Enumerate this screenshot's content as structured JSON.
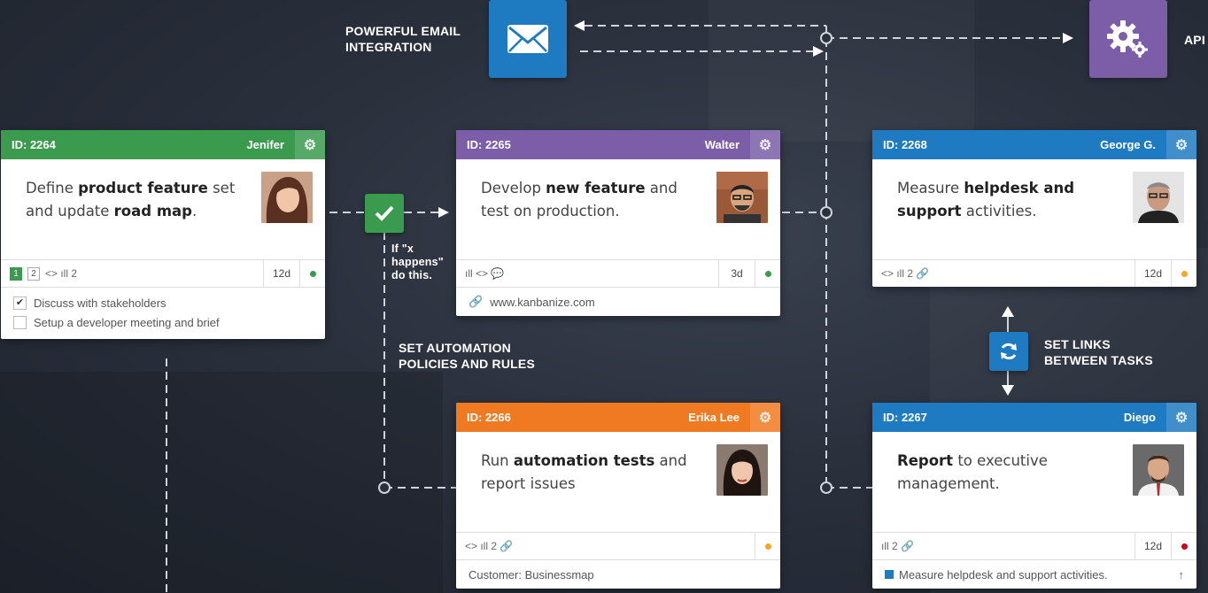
{
  "labels": {
    "email": "POWERFUL EMAIL\nINTEGRATION",
    "api": "API",
    "condition": "If \"x\nhappens\"\ndo this.",
    "automation": "SET AUTOMATION\nPOLICIES AND RULES",
    "links": "SET LINKS\nBETWEEN TASKS"
  },
  "icons": {
    "email": "envelope-icon",
    "api": "gears-icon",
    "rule": "checkmark-icon",
    "link": "refresh-link-icon"
  },
  "colors": {
    "green": "#3a9a4e",
    "purple": "#7b5ea7",
    "blue": "#1f7bc1",
    "orange": "#f07a22",
    "email_box": "#1f7bc1",
    "api_box": "#7b5ea7"
  },
  "cards": {
    "c2264": {
      "id": "ID: 2264",
      "owner": "Jenifer",
      "title_pre": "Define ",
      "title_b1": "product feature",
      "title_mid": " set and update ",
      "title_b2": "road map",
      "title_post": ".",
      "footer_icons": "<> ıll 2",
      "badge1": "1",
      "badge2": "2",
      "days": "12d",
      "checklist": [
        {
          "checked": true,
          "text": "Discuss with stakeholders"
        },
        {
          "checked": false,
          "text": "Setup a developer meeting and brief"
        }
      ]
    },
    "c2265": {
      "id": "ID: 2265",
      "owner": "Walter",
      "title_pre": "Develop ",
      "title_b1": "new feature",
      "title_mid": " and test on production.",
      "footer_icons": "ıll <> 💬",
      "days": "3d",
      "link": "www.kanbanize.com"
    },
    "c2268": {
      "id": "ID: 2268",
      "owner": "George G.",
      "title_pre": "Measure ",
      "title_b1": "helpdesk and support",
      "title_mid": " activities.",
      "footer_icons": "<> ıll 2 🔗",
      "days": "12d"
    },
    "c2266": {
      "id": "ID: 2266",
      "owner": "Erika Lee",
      "title_pre": "Run ",
      "title_b1": "automation tests",
      "title_mid": " and report issues",
      "footer_icons": "<> ıll 2 🔗",
      "extra": "Customer: Businessmap"
    },
    "c2267": {
      "id": "ID: 2267",
      "owner": "Diego",
      "title_b1": "Report",
      "title_mid": " to executive management.",
      "footer_icons": "ıll 2 🔗",
      "days": "12d",
      "extra": "Measure helpdesk and support activities."
    }
  }
}
